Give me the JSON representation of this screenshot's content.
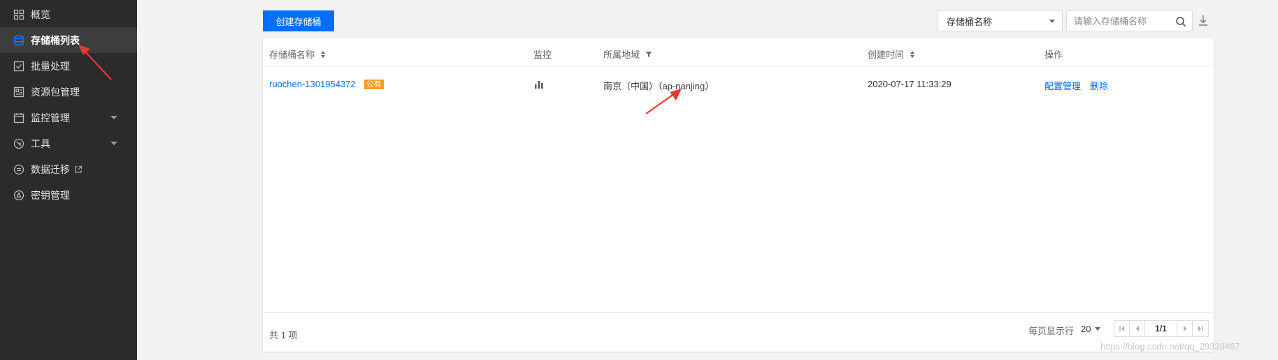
{
  "sidebar": {
    "items": [
      {
        "label": "概览",
        "icon": "grid-icon"
      },
      {
        "label": "存储桶列表",
        "icon": "bucket-icon"
      },
      {
        "label": "批量处理",
        "icon": "check-square-icon"
      },
      {
        "label": "资源包管理",
        "icon": "package-icon"
      },
      {
        "label": "监控管理",
        "icon": "calendar-icon"
      },
      {
        "label": "工具",
        "icon": "tool-icon"
      },
      {
        "label": "数据迁移",
        "icon": "migrate-icon"
      },
      {
        "label": "密钥管理",
        "icon": "key-icon"
      }
    ],
    "active_index": 1,
    "active_color": "#3d3d3d"
  },
  "toolbar": {
    "create_label": "创建存储桶",
    "filter_select_value": "存储桶名称",
    "search_placeholder": "请输入存储桶名称"
  },
  "table": {
    "headers": [
      "存储桶名称",
      "监控",
      "所属地域",
      "创建时间",
      "操作"
    ],
    "rows": [
      {
        "name": "ruochen-1301954372",
        "badge": "公有",
        "region": "南京（中国）（ap-nanjing）",
        "created": "2020-07-17 11:33:29",
        "actions": [
          "配置管理",
          "删除"
        ]
      }
    ]
  },
  "footer": {
    "total": "共 1 项",
    "per_page_label": "每页显示行",
    "per_page_value": "20",
    "page_indicator": "1/1"
  },
  "watermark": "https://blog.csdn.net/qq_29339467",
  "colors": {
    "primary": "#006eff",
    "sidebar_bg": "#2b2b2b",
    "badge": "#ff9c19",
    "arrow": "#e53935"
  }
}
